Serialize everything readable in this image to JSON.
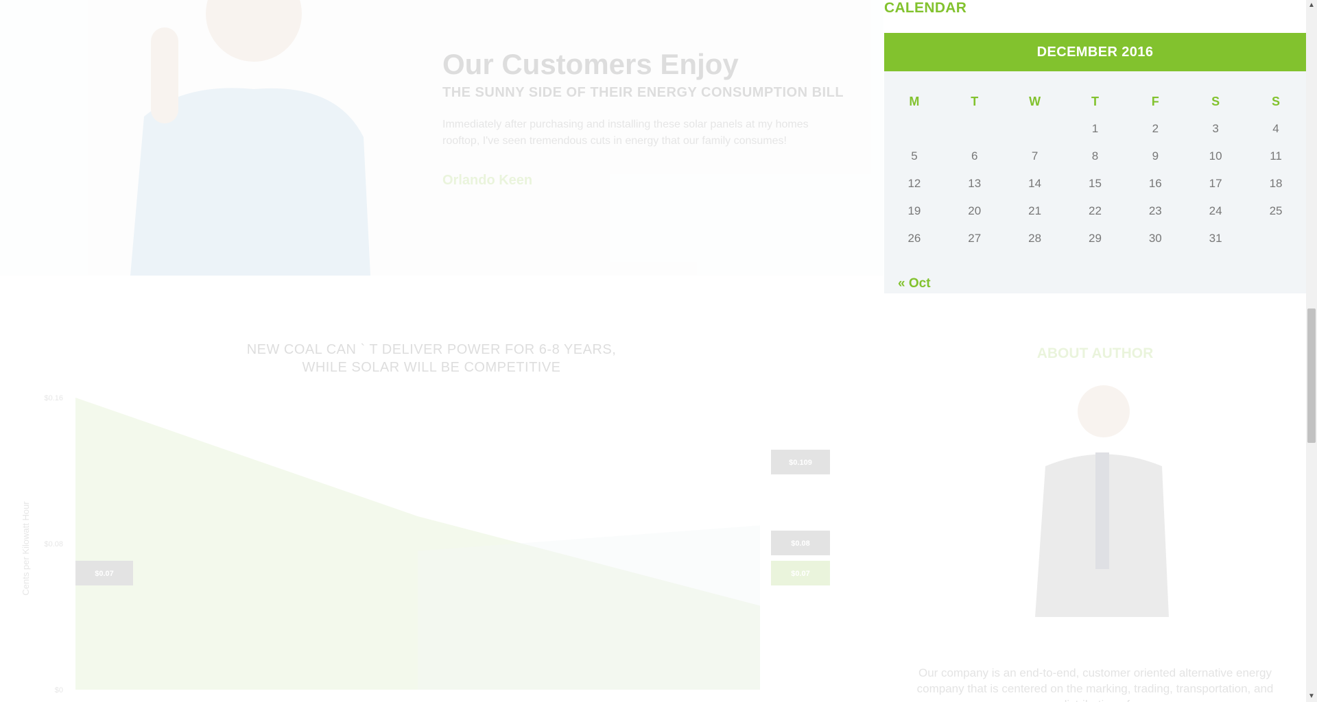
{
  "testimonial": {
    "title": "Our Customers Enjoy",
    "subtitle": "THE SUNNY SIDE OF THEIR ENERGY CONSUMPTION BILL",
    "quote": "Immediately after purchasing and installing these solar panels at my homes rooftop, I've seen tremendous cuts in energy that our family consumes!",
    "author": "Orlando Keen"
  },
  "chart": {
    "title_line1": "NEW COAL CAN ` T DELIVER POWER FOR 6-8 YEARS,",
    "title_line2": "WHILE SOLAR WILL BE COMPETITIVE"
  },
  "chart_data": {
    "type": "area",
    "title": "NEW COAL CAN ` T DELIVER POWER FOR 6-8 YEARS, WHILE SOLAR WILL BE COMPETITIVE",
    "ylabel": "Cents per Kilowatt Hour",
    "yticks": [
      "$0",
      "$0.08",
      "$0.16"
    ],
    "ylim": [
      0,
      0.16
    ],
    "series": [
      {
        "color": "#82c22e",
        "values": [
          0.16,
          0.095,
          0.046
        ]
      },
      {
        "color": "#a9c0cf",
        "values": [
          null,
          0.076,
          0.09
        ]
      }
    ],
    "labels_left": [
      {
        "text": "$0.07",
        "color": "#555555"
      }
    ],
    "labels_right": [
      {
        "text": "$0.109",
        "color": "#555555"
      },
      {
        "text": "$0.08",
        "color": "#555555"
      },
      {
        "text": "$0.07",
        "color": "#82c22e"
      }
    ]
  },
  "calendar": {
    "heading": "CALENDAR",
    "caption": "DECEMBER 2016",
    "weekdays": [
      "M",
      "T",
      "W",
      "T",
      "F",
      "S",
      "S"
    ],
    "weeks": [
      [
        "",
        "",
        "",
        "1",
        "2",
        "3",
        "4"
      ],
      [
        "5",
        "6",
        "7",
        "8",
        "9",
        "10",
        "11"
      ],
      [
        "12",
        "13",
        "14",
        "15",
        "16",
        "17",
        "18"
      ],
      [
        "19",
        "20",
        "21",
        "22",
        "23",
        "24",
        "25"
      ],
      [
        "26",
        "27",
        "28",
        "29",
        "30",
        "31",
        ""
      ]
    ],
    "prev_link": "« Oct"
  },
  "about": {
    "title": "ABOUT AUTHOR",
    "text": "Our company is an end-to-end, customer oriented alternative energy company that is centered on the marking, trading, transportation, and distribution of"
  },
  "colors": {
    "accent": "#82c22e",
    "calendar_bg": "#f2f5f7"
  },
  "icons": {
    "scroll_up": "▲",
    "scroll_down": "▼"
  }
}
